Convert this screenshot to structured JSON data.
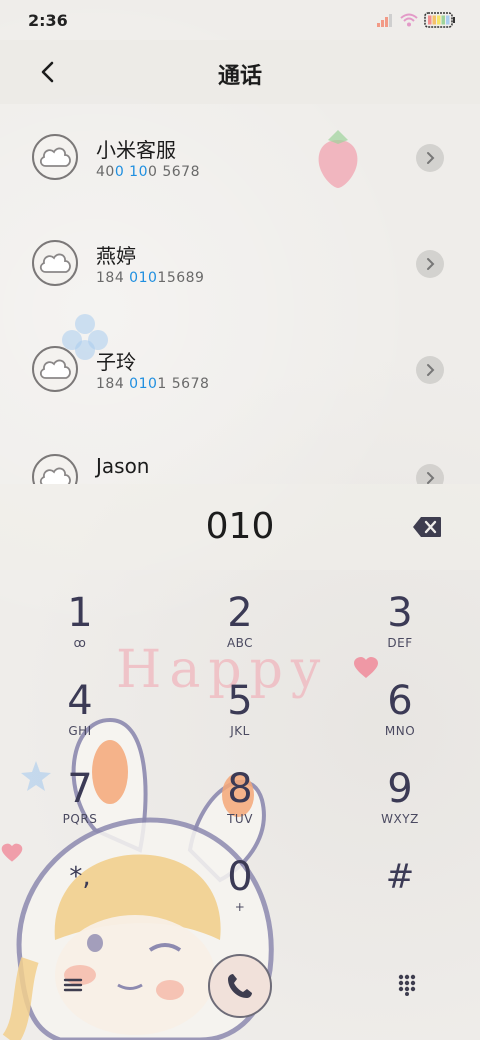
{
  "status_bar": {
    "time": "2:36",
    "icons": [
      "signal-icon",
      "wifi-icon",
      "battery-icon"
    ]
  },
  "header": {
    "title": "通话",
    "back_icon": "chevron-left-icon"
  },
  "contacts": [
    {
      "name": "小米客服",
      "number_parts": [
        "40",
        "0 10",
        "0 5678"
      ]
    },
    {
      "name": "燕婷",
      "number_parts": [
        "184 ",
        "010",
        "15689"
      ]
    },
    {
      "name": "子玲",
      "number_parts": [
        "184 ",
        "010",
        "1 5678"
      ]
    },
    {
      "name": "Jason",
      "number_parts": [
        "",
        "",
        ""
      ]
    }
  ],
  "dialer": {
    "input": "010",
    "keys": [
      {
        "digit": "1",
        "letters": "ꝏ"
      },
      {
        "digit": "2",
        "letters": "ABC"
      },
      {
        "digit": "3",
        "letters": "DEF"
      },
      {
        "digit": "4",
        "letters": "GHI"
      },
      {
        "digit": "5",
        "letters": "JKL"
      },
      {
        "digit": "6",
        "letters": "MNO"
      },
      {
        "digit": "7",
        "letters": "PQRS"
      },
      {
        "digit": "8",
        "letters": "TUV"
      },
      {
        "digit": "9",
        "letters": "WXYZ"
      },
      {
        "digit": "*,",
        "letters": ""
      },
      {
        "digit": "0",
        "letters": "+"
      },
      {
        "digit": "#",
        "letters": ""
      }
    ]
  },
  "colors": {
    "background": "#efedea",
    "highlight": "#1f8fe0",
    "key_text": "#3b3a55",
    "call_button": "#f1e1da"
  },
  "decor": {
    "happy_text": "Happy"
  }
}
